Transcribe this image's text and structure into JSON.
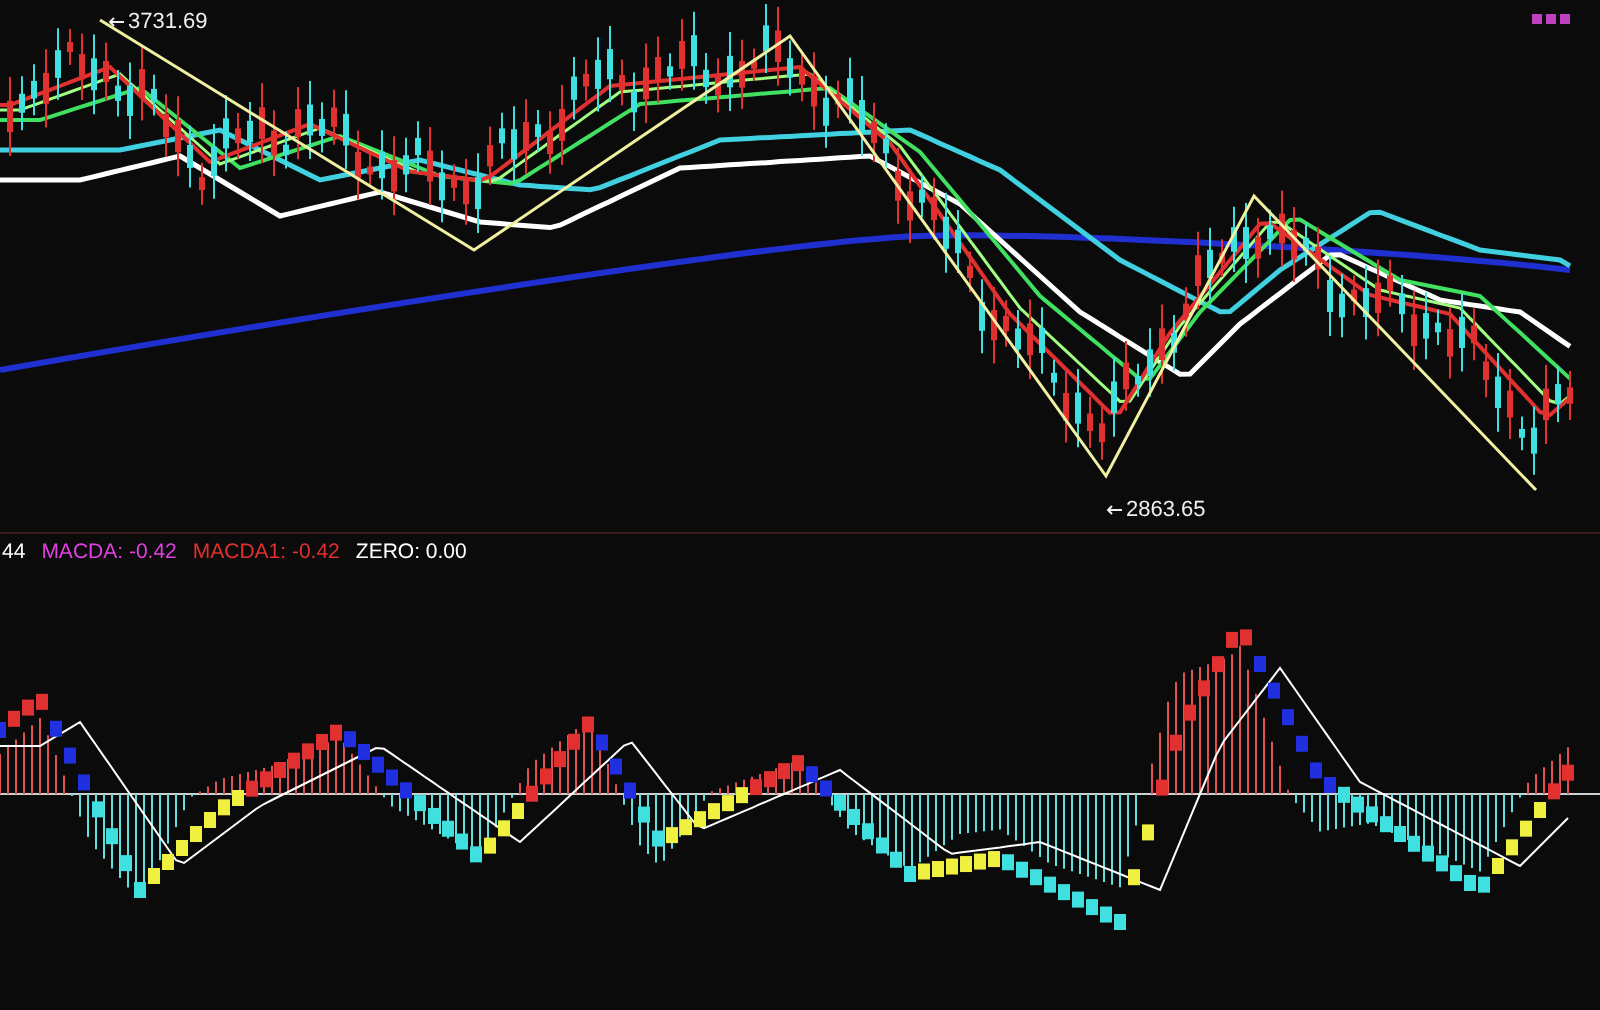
{
  "price_panel": {
    "high_label": "3731.69",
    "low_label": "2863.65"
  },
  "macd_panel": {
    "legend": [
      {
        "label": "44",
        "color": "#ffffff"
      },
      {
        "label": "MACDA: -0.42",
        "color": "#e040e0"
      },
      {
        "label": "MACDA1: -0.42",
        "color": "#e03030"
      },
      {
        "label": "ZERO: 0.00",
        "color": "#ffffff"
      }
    ]
  }
}
